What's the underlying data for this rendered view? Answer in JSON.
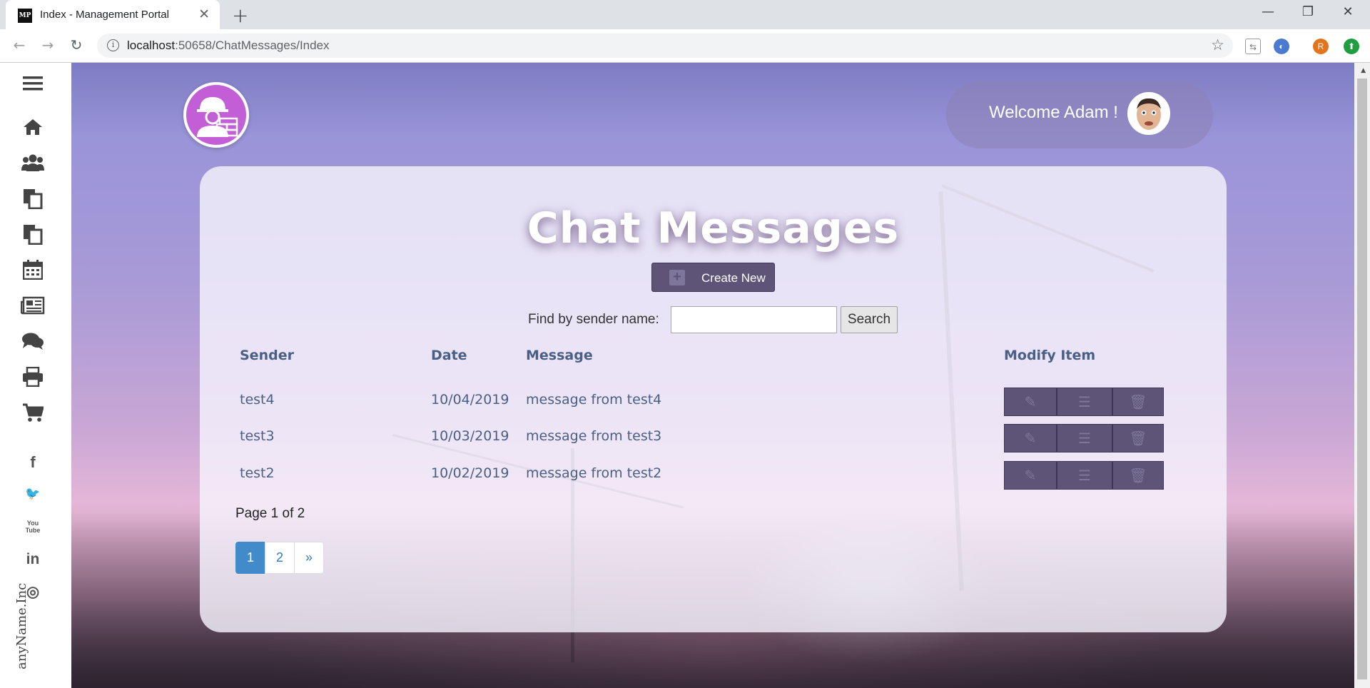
{
  "browser": {
    "tab_title": "Index - Management Portal",
    "favicon_text": "MP",
    "url_host": "localhost",
    "url_rest": ":50658/ChatMessages/Index",
    "extension_letter": "R"
  },
  "sidebar": {
    "icons": [
      "menu-icon",
      "home-icon",
      "users-icon",
      "documents-icon",
      "documents-alt-icon",
      "calendar-icon",
      "newspaper-icon",
      "chat-icon",
      "print-icon",
      "cart-icon"
    ],
    "social": {
      "facebook": "f",
      "twitter": "🐦",
      "youtube": "You Tube",
      "linkedin": "in",
      "instagram": "◎"
    },
    "company": "anyName.Inc"
  },
  "header": {
    "welcome": "Welcome Adam !"
  },
  "main": {
    "title": "Chat Messages",
    "create_label": "Create New",
    "find_label": "Find by sender name:",
    "search_value": "",
    "search_button": "Search",
    "columns": {
      "sender": "Sender",
      "date": "Date",
      "message": "Message",
      "modify": "Modify Item"
    },
    "rows": [
      {
        "sender": "test4",
        "date": "10/04/2019",
        "message": "message from test4"
      },
      {
        "sender": "test3",
        "date": "10/03/2019",
        "message": "message from test3"
      },
      {
        "sender": "test2",
        "date": "10/02/2019",
        "message": "message from test2"
      }
    ],
    "page_info": "Page 1 of 2",
    "pager": {
      "p1": "1",
      "p2": "2",
      "next": "»"
    }
  }
}
